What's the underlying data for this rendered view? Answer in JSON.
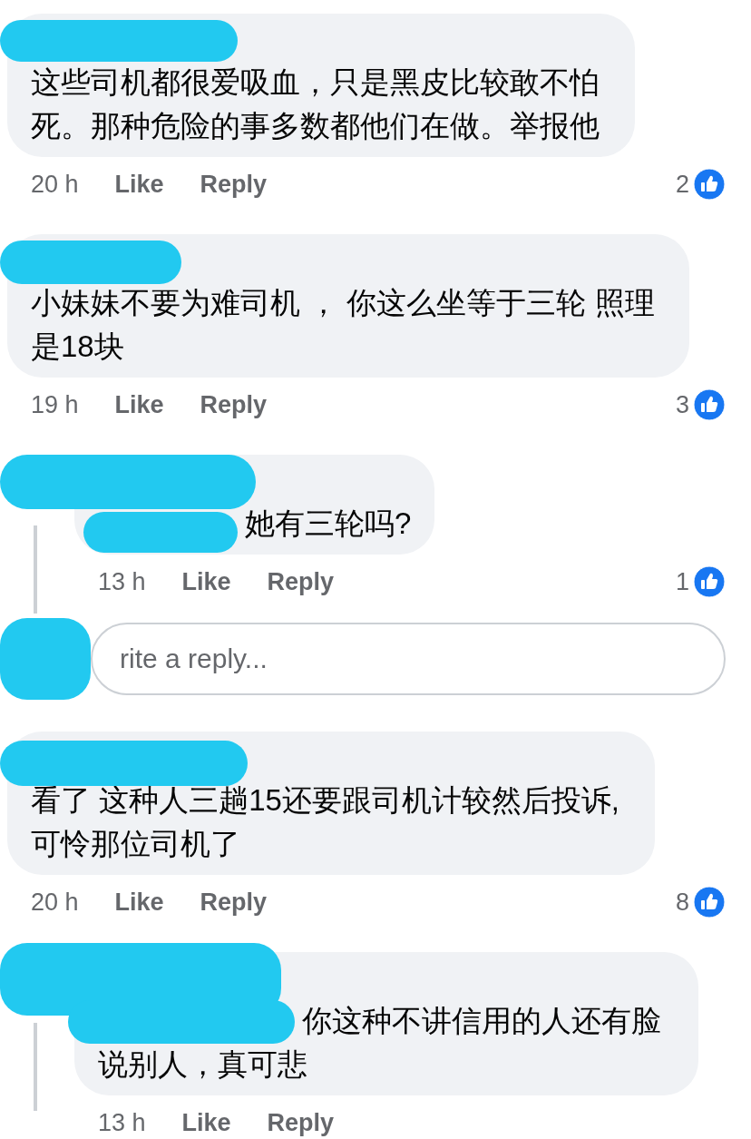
{
  "thread": [
    {
      "kind": "comment",
      "author_redacted": true,
      "text": "这些司机都很爱吸血，只是黑皮比较敢不怕死。那种危险的事多数都他们在做。举报他",
      "time": "20 h",
      "like_label": "Like",
      "reply_label": "Reply",
      "reactions": "2"
    },
    {
      "kind": "comment",
      "author_redacted": true,
      "text": "小妹妹不要为难司机 ， 你这么坐等于三轮 照理是18块",
      "time": "19 h",
      "like_label": "Like",
      "reply_label": "Reply",
      "reactions": "3"
    },
    {
      "kind": "reply",
      "author_redacted": true,
      "mention_redacted": true,
      "text": "她有三轮吗?",
      "time": "13 h",
      "like_label": "Like",
      "reply_label": "Reply",
      "reactions": "1"
    },
    {
      "kind": "reply_box",
      "author_redacted": true,
      "placeholder": "rite a reply..."
    },
    {
      "kind": "comment",
      "author_redacted": true,
      "text": "看了 这种人三趟15还要跟司机计较然后投诉,可怜那位司机了",
      "time": "20 h",
      "like_label": "Like",
      "reply_label": "Reply",
      "reactions": "8"
    },
    {
      "kind": "reply",
      "author_redacted": true,
      "mention_redacted": true,
      "text": "你这种不讲信用的人还有脸说别人，真可悲",
      "time": "13 h",
      "like_label": "Like",
      "reply_label": "Reply"
    }
  ]
}
